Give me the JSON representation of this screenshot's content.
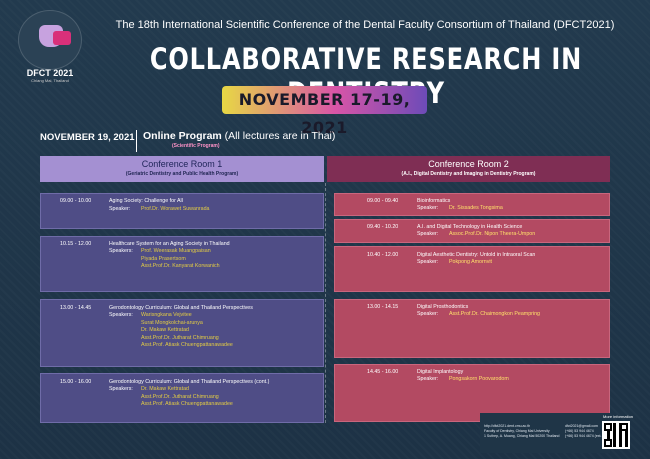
{
  "header": {
    "logo_name": "DFCT 2021",
    "logo_sub": "Chiang Mai, Thailand",
    "conference_line": "The 18th International Scientific Conference of the Dental Faculty Consortium of Thailand (DFCT2021)",
    "title": "COLLABORATIVE RESEARCH IN DENTISTRY",
    "dates": "NOVEMBER 17-19, 2021"
  },
  "program": {
    "day": "NOVEMBER 19, 2021",
    "title_bold": "Online Program",
    "title_note": " (All lectures are in Thai)",
    "subtitle": "(Scientific Program)"
  },
  "rooms": [
    {
      "name": "Conference Room 1",
      "desc": "(Geriatric Dentistry and Public Health Program)",
      "sessions": [
        {
          "time": "09.00 - 10.00",
          "topic": "Aging Society: Challenge for All",
          "speaker_label": "Speaker:",
          "speakers": [
            "Prof.Dr. Worawet Suwanrada"
          ]
        },
        {
          "time": "10.15 - 12.00",
          "topic": "Healthcare System for an Aging Society in Thailand",
          "speaker_label": "Speakers:",
          "speakers": [
            "Prof. Weerasak Muangpaisan",
            "Piyada Prasertsom",
            "Asst.Prof.Dr. Kanyarat Korwanich"
          ]
        },
        {
          "time": "13.00 - 14.45",
          "topic": "Gerodontology Curriculum: Global and Thailand Perspectives",
          "speaker_label": "Speakers:",
          "speakers": [
            "Warisngkana Vejvitee",
            "Surat Mongkolchai-arunya",
            "Dr. Makaw Kettratad",
            "Asst.Prof.Dr. Jutharat Chimruang",
            "Asst.Prof. Atiask Chuengpattanawadee"
          ]
        },
        {
          "time": "15.00 - 16.00",
          "topic": "Gerodontology Curriculum: Global and Thailand Perspectives (cont.)",
          "speaker_label": "Speakers:",
          "speakers": [
            "Dr. Makaw Kettratad",
            "Asst.Prof.Dr. Jutharat Chimruang",
            "Asst.Prof. Atiask Chuengpattanawadee"
          ]
        }
      ]
    },
    {
      "name": "Conference Room 2",
      "desc": "(A.I., Digital Dentistry and Imaging in Dentistry Program)",
      "sessions": [
        {
          "time": "09.00 - 09.40",
          "topic": "Bioinformatics",
          "speaker_label": "Speaker:",
          "speakers": [
            "Dr. Sissades Tongsima"
          ]
        },
        {
          "time": "09.40 - 10.20",
          "topic": "A.I. and Digital Technology in Health Science",
          "speaker_label": "Speaker:",
          "speakers": [
            "Assoc.Prof.Dr. Nipon Theera-Umpon"
          ]
        },
        {
          "time": "10.40 - 12.00",
          "topic": "Digital Aesthetic Dentistry: Untold in Intraoral Scan",
          "speaker_label": "Speaker:",
          "speakers": [
            "Pokpong Amornvit"
          ]
        },
        {
          "time": "13.00 - 14.15",
          "topic": "Digital Prosthodontics",
          "speaker_label": "Speaker:",
          "speakers": [
            "Asst.Prof.Dr. Chaimongkon Peampring"
          ]
        },
        {
          "time": "14.45 - 16.00",
          "topic": "Digital Implantology",
          "speaker_label": "Speaker:",
          "speakers": [
            "Pongsakorn Poovarodom"
          ]
        }
      ]
    }
  ],
  "footer": {
    "website": "http://dfct2021.dent.cmu.ac.th",
    "org": "Faculty of Dentistry, Chiang Mai University",
    "address": "1 Suthep, A. Muang, Chiang Mai 50200 Thailand",
    "email": "dfct2021@gmail.com",
    "phone1": "(+66) 53 944 4674",
    "phone2": "(+66) 53 944 4674 (ext. 29)",
    "more_info": "More information"
  }
}
